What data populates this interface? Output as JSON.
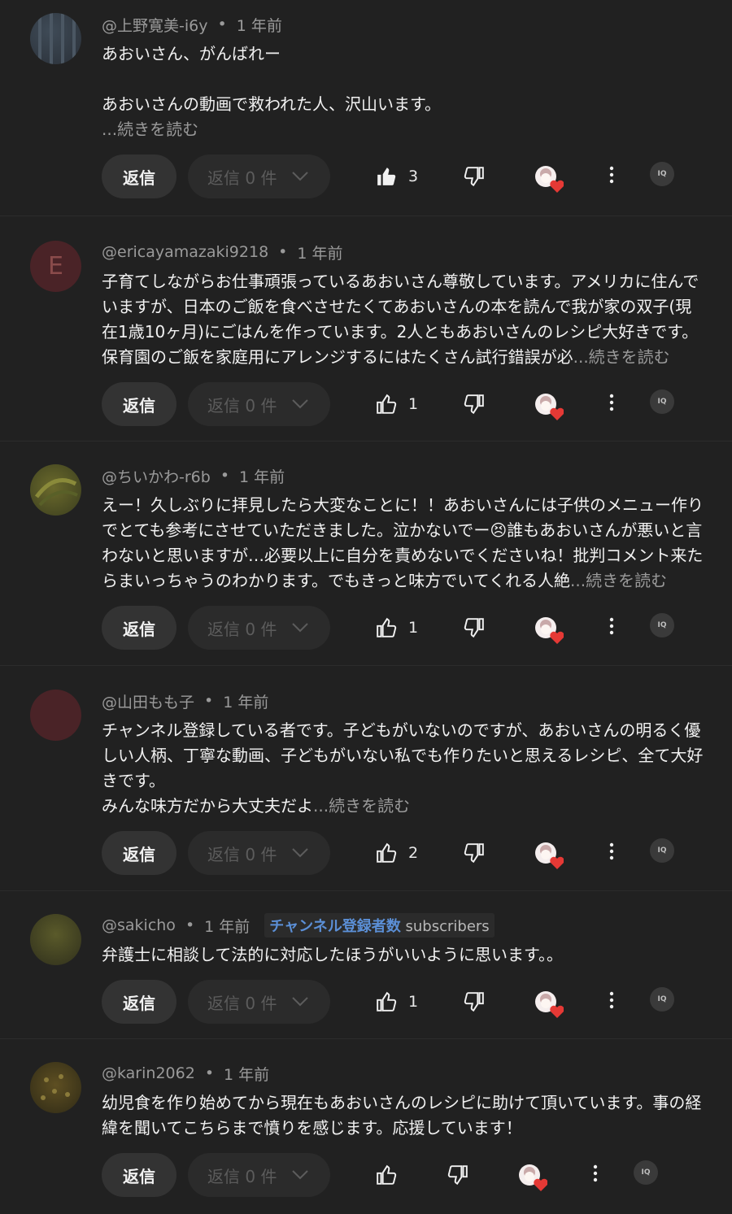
{
  "ui": {
    "reply_label": "返信",
    "replies_label": "返信 0 件",
    "read_more": "...続きを読む",
    "dot": "•",
    "iq_label": "IQ"
  },
  "comments": [
    {
      "author": "@上野寛美-i6y",
      "time": "1 年前",
      "lines": [
        "あおいさん、がんばれー",
        "",
        "あおいさんの動画で救われた人、沢山います。"
      ],
      "likes": "3",
      "liked": true
    },
    {
      "author": "@ericayamazaki9218",
      "time": "1 年前",
      "avatar_letter": "E",
      "lines": [
        "子育てしながらお仕事頑張っているあおいさん尊敬しています。アメリカに住んでいますが、日本のご飯を食べさせたくてあおいさんの本を読んで我が家の双子(現在1歳10ヶ月)にごはんを作っています。2人ともあおいさんのレシピ大好きです。保育園のご飯を家庭用にアレンジするにはたくさん試行錯誤が必"
      ],
      "likes": "1"
    },
    {
      "author": "@ちいかわ-r6b",
      "time": "1 年前",
      "lines": [
        "えー！久しぶりに拝見したら大変なことに！！あおいさんには子供のメニュー作りでとても参考にさせていただきました。泣かないでー😣誰もあおいさんが悪いと言わないと思いますが…必要以上に自分を責めないでくださいね！批判コメント来たらまいっちゃうのわかります。でもきっと味方でいてくれる人絶"
      ],
      "likes": "1"
    },
    {
      "author": "@山田もも子",
      "time": "1 年前",
      "lines": [
        "チャンネル登録している者です。子どもがいないのですが、あおいさんの明るく優しい人柄、丁寧な動画、子どもがいない私でも作りたいと思えるレシピ、全て大好きです。",
        "みんな味方だから大丈夫だよ"
      ],
      "likes": "2"
    },
    {
      "author": "@sakicho",
      "time": "1 年前",
      "badge_main": "チャンネル登録者数",
      "badge_sub": "subscribers",
      "lines": [
        "弁護士に相談して法的に対応したほうがいいように思います。。"
      ],
      "likes": "1"
    },
    {
      "author": "@karin2062",
      "time": "1 年前",
      "lines": [
        "幼児食を作り始めてから現在もあおいさんのレシピに助けて頂いています。事の経緯を聞いてこちらまで憤りを感じます。応援しています！"
      ],
      "likes": ""
    }
  ]
}
